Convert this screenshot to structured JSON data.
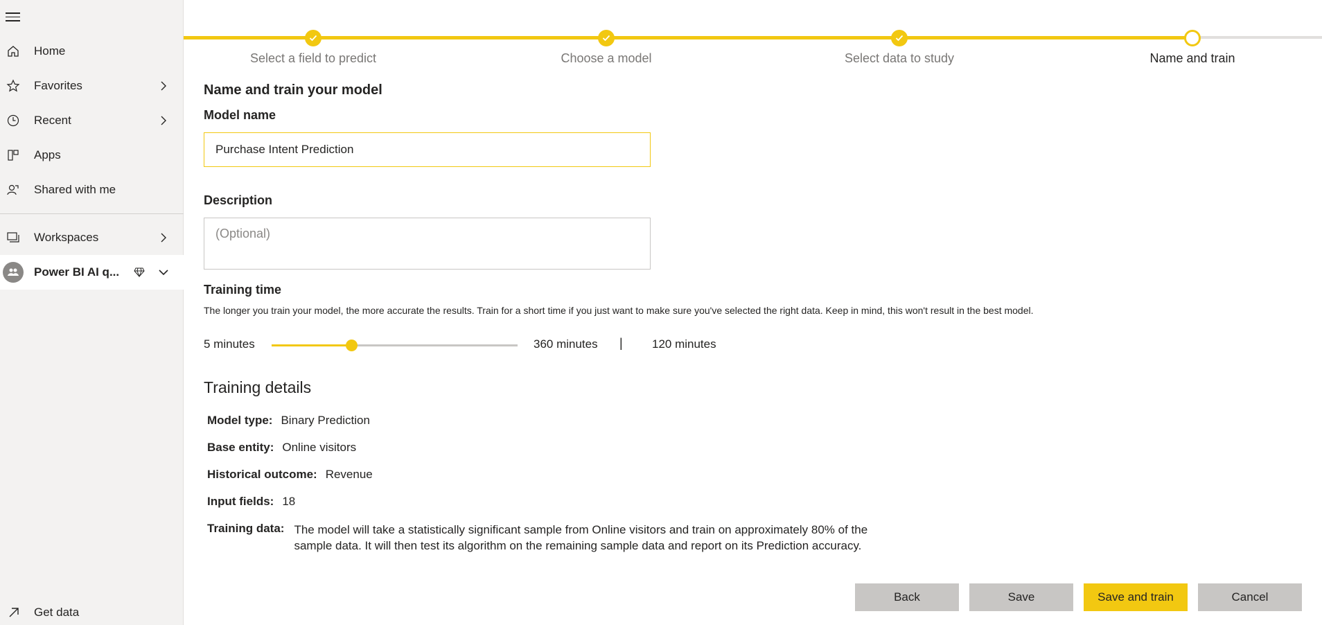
{
  "sidebar": {
    "items": [
      {
        "label": "Home",
        "icon": "home-icon"
      },
      {
        "label": "Favorites",
        "icon": "star-icon"
      },
      {
        "label": "Recent",
        "icon": "clock-icon"
      },
      {
        "label": "Apps",
        "icon": "apps-icon"
      },
      {
        "label": "Shared with me",
        "icon": "shared-icon"
      },
      {
        "label": "Workspaces",
        "icon": "workspaces-icon"
      }
    ],
    "workspace": {
      "label": "Power BI AI q..."
    },
    "get_data": "Get data"
  },
  "stepper": {
    "steps": [
      {
        "label": "Select a field to predict",
        "state": "done"
      },
      {
        "label": "Choose a model",
        "state": "done"
      },
      {
        "label": "Select data to study",
        "state": "done"
      },
      {
        "label": "Name and train",
        "state": "current"
      }
    ]
  },
  "form": {
    "heading": "Name and train your model",
    "model_name_label": "Model name",
    "model_name_value": "Purchase Intent Prediction",
    "description_label": "Description",
    "description_placeholder": "(Optional)"
  },
  "training_time": {
    "title": "Training time",
    "hint": "The longer you train your model, the more accurate the results. Train for a short time if you just want to make sure you've selected the right data. Keep in mind, this won't result in the best model.",
    "min_label": "5 minutes",
    "max_label": "360 minutes",
    "separator": "|",
    "current_label": "120 minutes",
    "min_value": 5,
    "max_value": 360,
    "current_value": 120
  },
  "details": {
    "title": "Training details",
    "model_type_key": "Model type:",
    "model_type_value": "Binary Prediction",
    "base_entity_key": "Base entity:",
    "base_entity_value": "Online visitors",
    "historical_outcome_key": "Historical outcome:",
    "historical_outcome_value": "Revenue",
    "input_fields_key": "Input fields:",
    "input_fields_value": "18",
    "training_data_key": "Training data:",
    "training_data_value": "The model will take a statistically significant sample from Online visitors and train on approximately 80% of the sample data. It will then test its algorithm on the remaining sample data and report on its Prediction accuracy."
  },
  "buttons": {
    "back": "Back",
    "save": "Save",
    "save_and_train": "Save and train",
    "cancel": "Cancel"
  },
  "colors": {
    "accent": "#f2c811",
    "sidebar_bg": "#f3f2f1",
    "button_gray": "#c8c6c4"
  }
}
